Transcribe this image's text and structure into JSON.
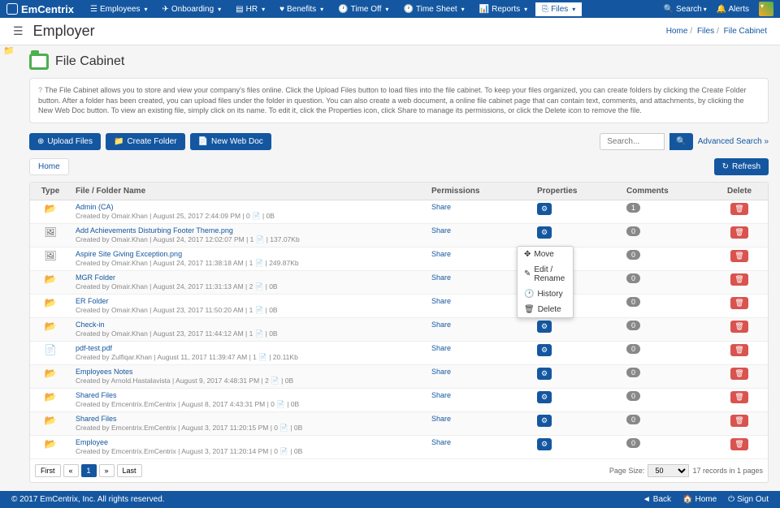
{
  "brand": "EmCentrix",
  "nav": [
    {
      "icon": "☰",
      "label": "Employees"
    },
    {
      "icon": "✈",
      "label": "Onboarding"
    },
    {
      "icon": "▤",
      "label": "HR"
    },
    {
      "icon": "♥",
      "label": "Benefits"
    },
    {
      "icon": "🕐",
      "label": "Time Off"
    },
    {
      "icon": "🕐",
      "label": "Time Sheet"
    },
    {
      "icon": "📊",
      "label": "Reports"
    },
    {
      "icon": "⎘",
      "label": "Files"
    }
  ],
  "nav_right": {
    "search": "Search",
    "alerts": "Alerts"
  },
  "page_title": "Employer",
  "breadcrumb": [
    "Home",
    "Files",
    "File Cabinet"
  ],
  "section_title": "File Cabinet",
  "info_text": "The File Cabinet allows you to store and view your company's files online. Click the Upload Files button to load files into the file cabinet. To keep your files organized, you can create folders by clicking the Create Folder button. After a folder has been created, you can upload files under the folder in question. You can also create a web document, a online file cabinet page that can contain text, comments, and attachments, by clicking the New Web Doc button. To view an existing file, simply click on its name. To edit it, click the Properties icon, click Share to manage its permissions, or click the Delete icon to remove the file.",
  "buttons": {
    "upload": "Upload Files",
    "create_folder": "Create Folder",
    "new_doc": "New Web Doc",
    "refresh": "Refresh"
  },
  "search_placeholder": "Search...",
  "advanced_search": "Advanced Search »",
  "home_tab": "Home",
  "columns": {
    "type": "Type",
    "name": "File / Folder Name",
    "permissions": "Permissions",
    "properties": "Properties",
    "comments": "Comments",
    "delete": "Delete"
  },
  "share_label": "Share",
  "dropdown": {
    "move": "Move",
    "edit": "Edit / Rename",
    "history": "History",
    "delete": "Delete"
  },
  "rows": [
    {
      "icon": "📂",
      "name": "Admin (CA)",
      "meta": "Created by Omair.Khan | August 25, 2017 2:44:09 PM | 0 📄 | 0B",
      "comments": "1"
    },
    {
      "icon": "🖼",
      "name": "Add Achievements Disturbing Footer Theme.png",
      "meta": "Created by Omair.Khan | August 24, 2017 12:02:07 PM | 1 📄 | 137.07Kb",
      "comments": "0"
    },
    {
      "icon": "🖼",
      "name": "Aspire Site Giving Exception.png",
      "meta": "Created by Omair.Khan | August 24, 2017 11:38:18 AM | 1 📄 | 249.87Kb",
      "comments": "0"
    },
    {
      "icon": "📂",
      "name": "MGR Folder",
      "meta": "Created by Omair.Khan | August 24, 2017 11:31:13 AM | 2 📄 | 0B",
      "comments": "0"
    },
    {
      "icon": "📂",
      "name": "ER Folder",
      "meta": "Created by Omair.Khan | August 23, 2017 11:50:20 AM | 1 📄 | 0B",
      "comments": "0"
    },
    {
      "icon": "📂",
      "name": "Check-in",
      "meta": "Created by Omair.Khan | August 23, 2017 11:44:12 AM | 1 📄 | 0B",
      "comments": "0"
    },
    {
      "icon": "📄",
      "name": "pdf-test.pdf",
      "meta": "Created by Zulfiqar.Khan | August 11, 2017 11:39:47 AM | 1 📄 | 20.11Kb",
      "comments": "0"
    },
    {
      "icon": "📂",
      "name": "Employees Notes",
      "meta": "Created by Arnold.Hastalavista | August 9, 2017 4:48:31 PM | 2 📄 | 0B",
      "comments": "0"
    },
    {
      "icon": "📂",
      "name": "Shared Files",
      "meta": "Created by Emcentrix.EmCentrix | August 8, 2017 4:43:31 PM | 0 📄 | 0B",
      "comments": "0"
    },
    {
      "icon": "📂",
      "name": "Shared Files",
      "meta": "Created by Emcentrix.EmCentrix | August 3, 2017 11:20:15 PM | 0 📄 | 0B",
      "comments": "0"
    },
    {
      "icon": "📂",
      "name": "Employee",
      "meta": "Created by Emcentrix.EmCentrix | August 3, 2017 11:20:14 PM | 0 📄 | 0B",
      "comments": "0"
    }
  ],
  "pager": {
    "first": "First",
    "prev": "«",
    "current": "1",
    "next": "»",
    "last": "Last",
    "page_size_label": "Page Size:",
    "page_size": "50",
    "records_text": "17 records in 1 pages"
  },
  "footer": {
    "copyright": "© 2017 EmCentrix, Inc. All rights reserved.",
    "back": "Back",
    "home": "Home",
    "signout": "Sign Out"
  }
}
